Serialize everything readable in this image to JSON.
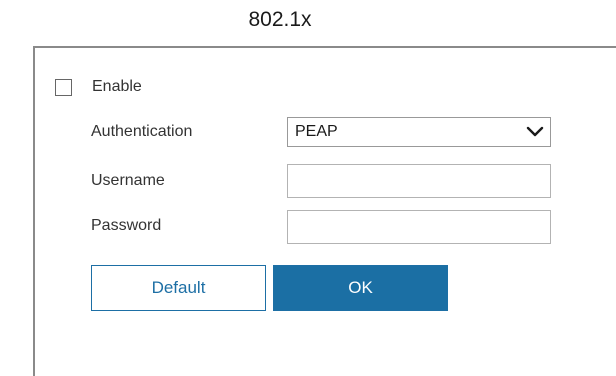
{
  "dialog": {
    "title": "802.1x"
  },
  "form": {
    "enable_label": "Enable",
    "enable_checked": false,
    "authentication_label": "Authentication",
    "authentication_value": "PEAP",
    "username_label": "Username",
    "username_value": "",
    "password_label": "Password",
    "password_value": ""
  },
  "buttons": {
    "default_label": "Default",
    "ok_label": "OK"
  },
  "icons": {
    "select_chevron": "chevron-down-icon"
  },
  "colors": {
    "accent": "#1b6fa4",
    "panel_border": "#8a8a8a"
  }
}
